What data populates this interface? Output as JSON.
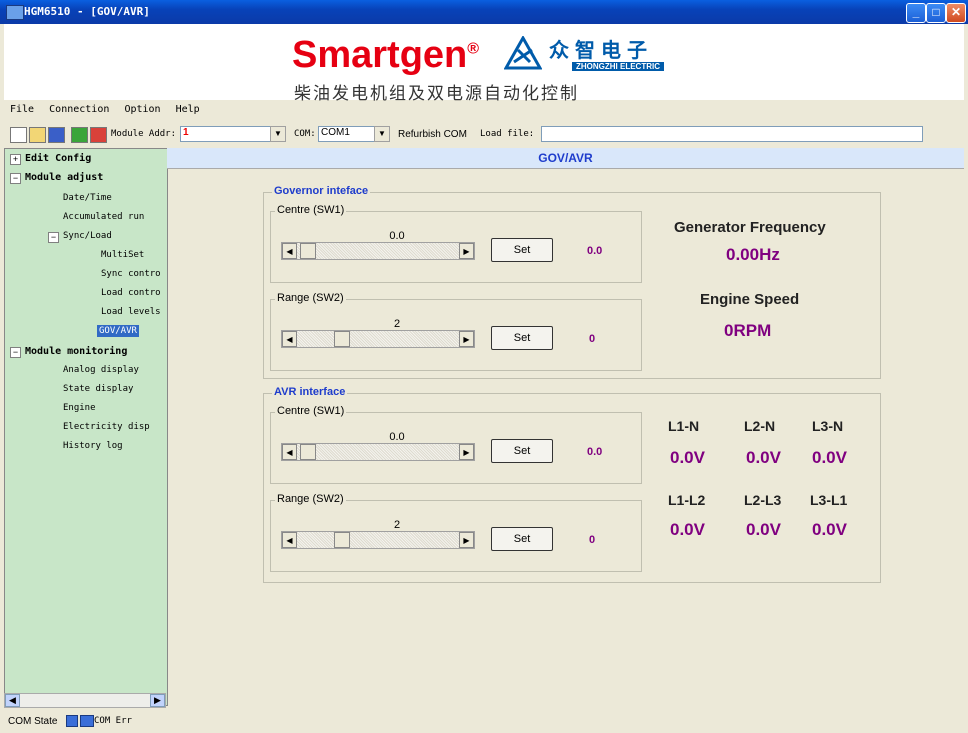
{
  "window": {
    "title": "HGM6510 - [GOV/AVR]"
  },
  "banner": {
    "brand": "Smartgen",
    "reg": "®",
    "cn_brand": "众智电子",
    "en_brand": "ZHONGZHI ELECTRIC",
    "slogan": "柴油发电机组及双电源自动化控制"
  },
  "menu": [
    "File",
    "Connection",
    "Option",
    "Help"
  ],
  "toolbar": {
    "module_addr_label": "Module Addr:",
    "module_addr_value": "1",
    "com_label": "COM:",
    "com_value": "COM1",
    "refurbish": "Refurbish COM",
    "load_file_label": "Load file:",
    "load_file_value": ""
  },
  "tree": {
    "edit_config": "Edit Config",
    "module_adjust": "Module adjust",
    "date_time": "Date/Time",
    "accumulated_run": "Accumulated run",
    "sync_load": "Sync/Load",
    "multiset": "MultiSet",
    "sync_control": "Sync contro",
    "load_control": "Load contro",
    "load_levels": "Load levels",
    "gov_avr": "GOV/AVR",
    "module_monitoring": "Module monitoring",
    "analog_display": "Analog display",
    "state_display": "State display",
    "engine": "Engine",
    "electricity_display": "Electricity disp",
    "history_log": "History log"
  },
  "content": {
    "header": "GOV/AVR",
    "governor": {
      "title": "Governor inteface",
      "centre": {
        "title": "Centre (SW1)",
        "slider_value": "0.0",
        "set": "Set",
        "readout": "0.0"
      },
      "range": {
        "title": "Range (SW2)",
        "slider_value": "2",
        "set": "Set",
        "readout": "0"
      },
      "freq_label": "Generator Frequency",
      "freq_value": "0.00Hz",
      "speed_label": "Engine Speed",
      "speed_value": "0RPM"
    },
    "avr": {
      "title": "AVR interface",
      "centre": {
        "title": "Centre (SW1)",
        "slider_value": "0.0",
        "set": "Set",
        "readout": "0.0"
      },
      "range": {
        "title": "Range (SW2)",
        "slider_value": "2",
        "set": "Set",
        "readout": "0"
      },
      "l1n_label": "L1-N",
      "l2n_label": "L2-N",
      "l3n_label": "L3-N",
      "l1n_value": "0.0V",
      "l2n_value": "0.0V",
      "l3n_value": "0.0V",
      "l1l2_label": "L1-L2",
      "l2l3_label": "L2-L3",
      "l3l1_label": "L3-L1",
      "l1l2_value": "0.0V",
      "l2l3_value": "0.0V",
      "l3l1_value": "0.0V"
    }
  },
  "status": {
    "com_state": "COM State",
    "com_err": "COM Err"
  }
}
